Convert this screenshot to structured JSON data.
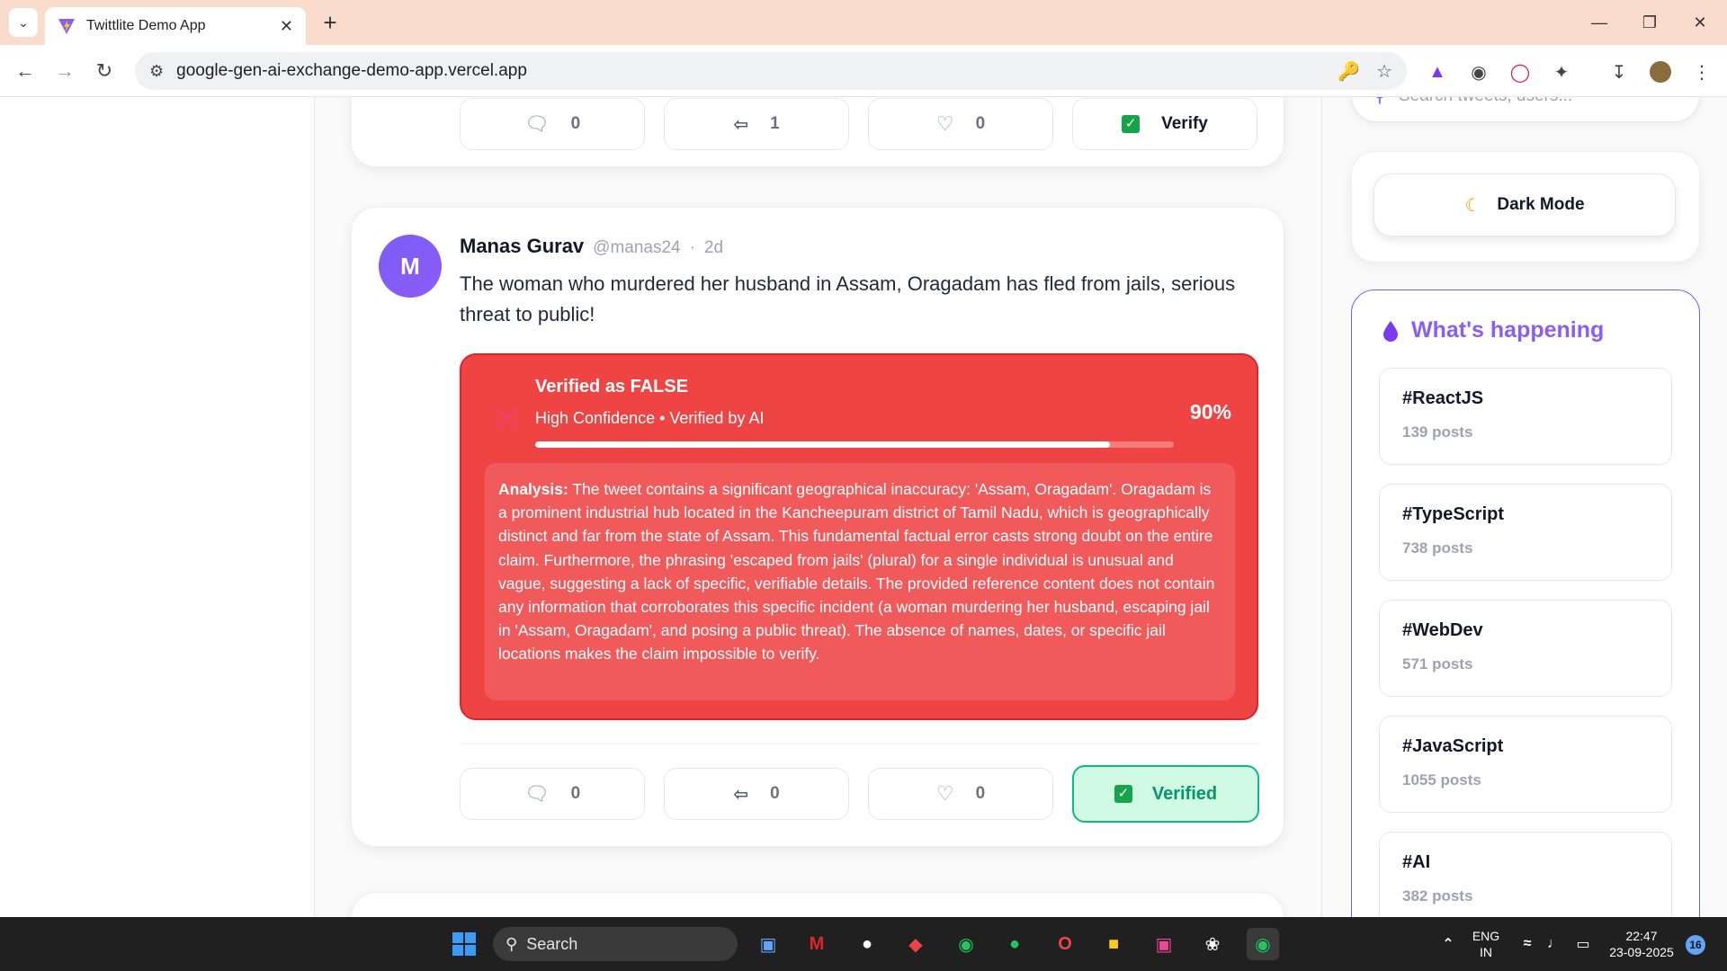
{
  "browser": {
    "tab_title": "Twittlite Demo App",
    "url": "google-gen-ai-exchange-demo-app.vercel.app"
  },
  "prev_tweet": {
    "reply_count": "0",
    "retweet_count": "1",
    "like_count": "0",
    "verify_label": "Verify"
  },
  "tweet": {
    "avatar_letter": "M",
    "author_name": "Manas Gurav",
    "handle": "@manas24",
    "separator": "·",
    "time": "2d",
    "text": "The woman who murdered her husband in Assam, Oragadam has fled from jails, serious threat to public!",
    "verdict": {
      "title": "Verified as FALSE",
      "subtitle": "High Confidence • Verified by AI",
      "confidence_label": "90%",
      "confidence": 0.9,
      "analysis_label": "Analysis:",
      "analysis_text": "The tweet contains a significant geographical inaccuracy: 'Assam, Oragadam'. Oragadam is a prominent industrial hub located in the Kancheepuram district of Tamil Nadu, which is geographically distinct and far from the state of Assam. This fundamental factual error casts strong doubt on the entire claim. Furthermore, the phrasing 'escaped from jails' (plural) for a single individual is unusual and vague, suggesting a lack of specific, verifiable details. The provided reference content does not contain any information that corroborates this specific incident (a woman murdering her husband, escaping jail in 'Assam, Oragadam', and posing a public threat). The absence of names, dates, or specific jail locations makes the claim impossible to verify."
    },
    "reply_count": "0",
    "retweet_count": "0",
    "like_count": "0",
    "verified_label": "Verified"
  },
  "sidebar": {
    "search_placeholder": "Search tweets, users...",
    "dark_mode_label": "Dark Mode",
    "happening_title": "What's happening",
    "trends": [
      {
        "tag": "#ReactJS",
        "count": "139 posts"
      },
      {
        "tag": "#TypeScript",
        "count": "738 posts"
      },
      {
        "tag": "#WebDev",
        "count": "571 posts"
      },
      {
        "tag": "#JavaScript",
        "count": "1055 posts"
      },
      {
        "tag": "#AI",
        "count": "382 posts"
      }
    ]
  },
  "taskbar": {
    "search_label": "Search",
    "lang_line1": "ENG",
    "lang_line2": "IN",
    "time": "22:47",
    "date": "23-09-2025",
    "notification_count": "16"
  },
  "colors": {
    "verdict_bg": "#ef4444",
    "accent": "#8b5cf6",
    "verified_green": "#10b981"
  }
}
